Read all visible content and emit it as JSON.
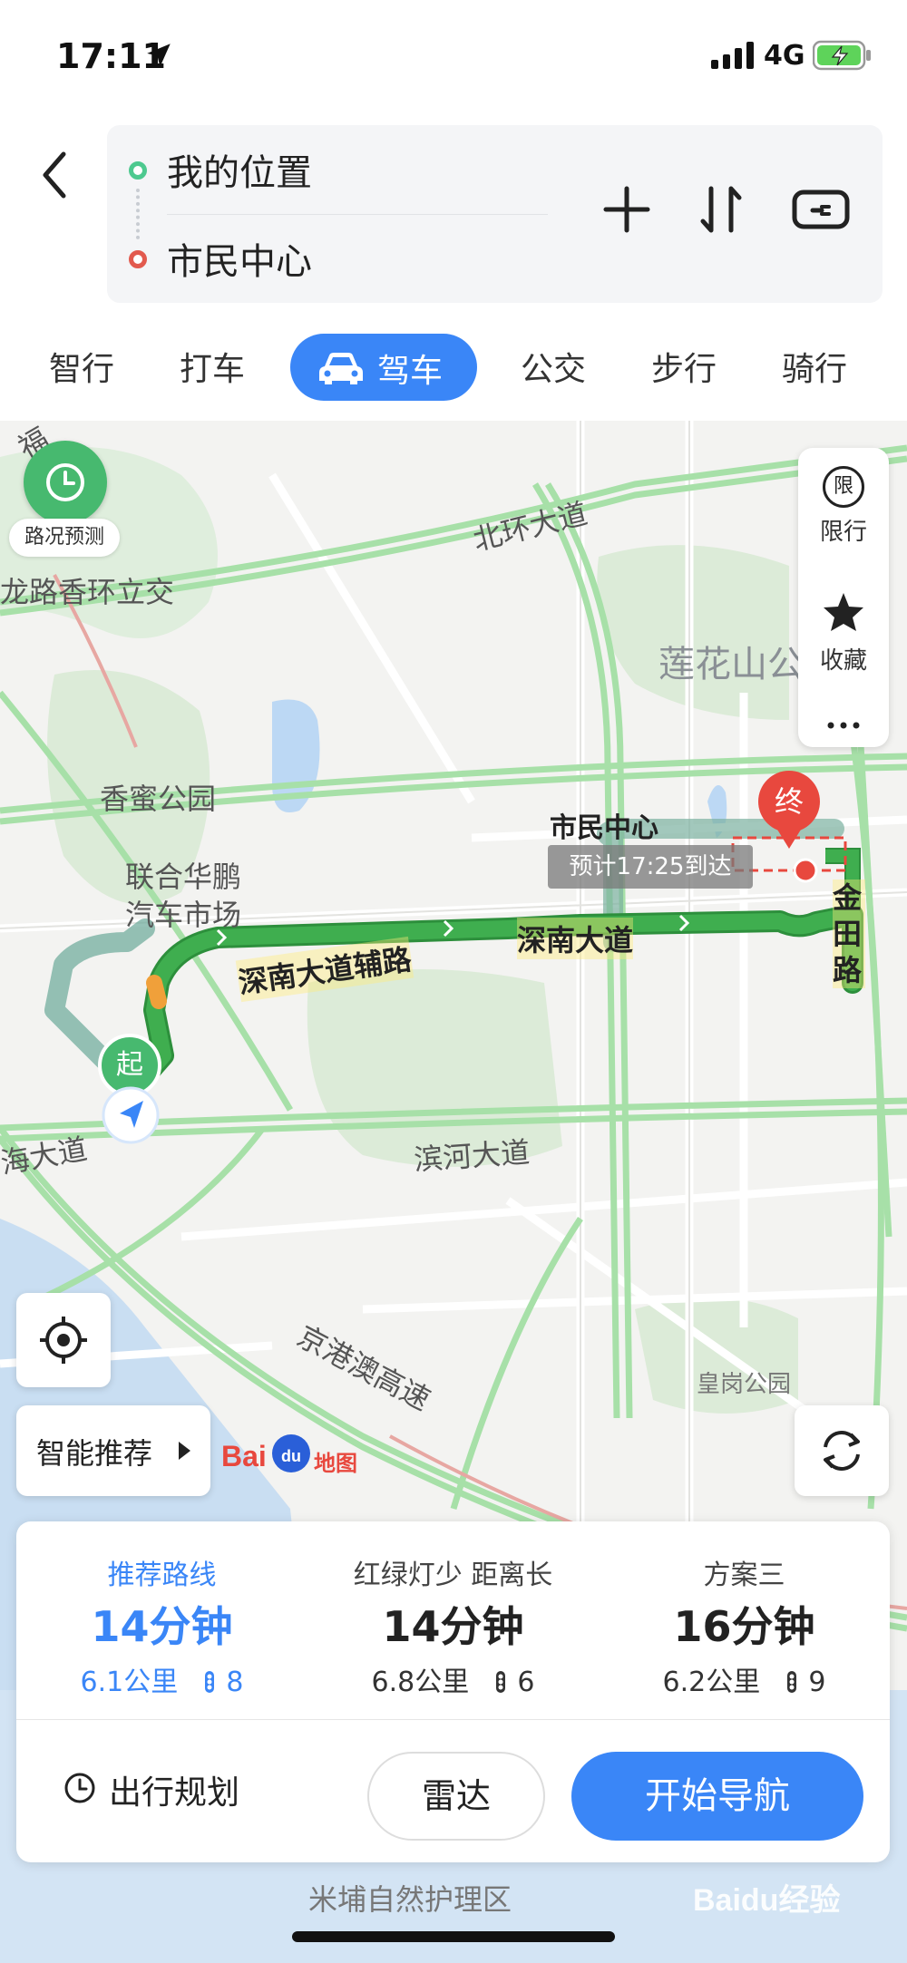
{
  "status_bar": {
    "time": "17:11",
    "network": "4G"
  },
  "route": {
    "from": "我的位置",
    "to": "市民中心"
  },
  "mode_tabs": [
    {
      "label": "智行"
    },
    {
      "label": "打车"
    },
    {
      "label": "驾车",
      "active": true
    },
    {
      "label": "公交"
    },
    {
      "label": "步行"
    },
    {
      "label": "骑行"
    }
  ],
  "map": {
    "traffic_forecast_label": "路况预测",
    "side_panel": {
      "restrict_label": "限行",
      "restrict_icon_char": "限",
      "favorite_label": "收藏"
    },
    "labels": {
      "beihuan": "北环大道",
      "huanglong": "龙路香环立交",
      "lianhuashan": "莲花山公",
      "xiangmi": "香蜜公园",
      "lianhe1": "联合华鹏",
      "lianhe2": "汽车市场",
      "shenzhen_fulu": "深南大道辅路",
      "shennan": "深南大道",
      "jintian": "金田路",
      "binhe": "滨河大道",
      "binhai": "海大道",
      "jinggang": "京港澳高速",
      "huanggang": "皇岗公园",
      "mipu": "米埔自然护理区",
      "fu": "福",
      "civic_center": "市民中心"
    },
    "start_marker": "起",
    "end_marker": "终",
    "eta": "预计17:25到达",
    "smart_recommend": "智能推荐",
    "logo_text": "Bai",
    "logo_text2": "du",
    "logo_text3": "地图",
    "watermark": "Baidu经验"
  },
  "routes": [
    {
      "tag": "推荐路线",
      "duration": "14分钟",
      "distance": "6.1公里",
      "lights": "8",
      "active": true
    },
    {
      "tag": "红绿灯少  距离长",
      "duration": "14分钟",
      "distance": "6.8公里",
      "lights": "6"
    },
    {
      "tag": "方案三",
      "duration": "16分钟",
      "distance": "6.2公里",
      "lights": "9"
    }
  ],
  "actions": {
    "plan": "出行规划",
    "radar": "雷达",
    "navigate": "开始导航"
  },
  "colors": {
    "accent": "#3a86f7",
    "route_green": "#3fae4f",
    "start_green": "#47b96f",
    "end_red": "#e8483e"
  }
}
